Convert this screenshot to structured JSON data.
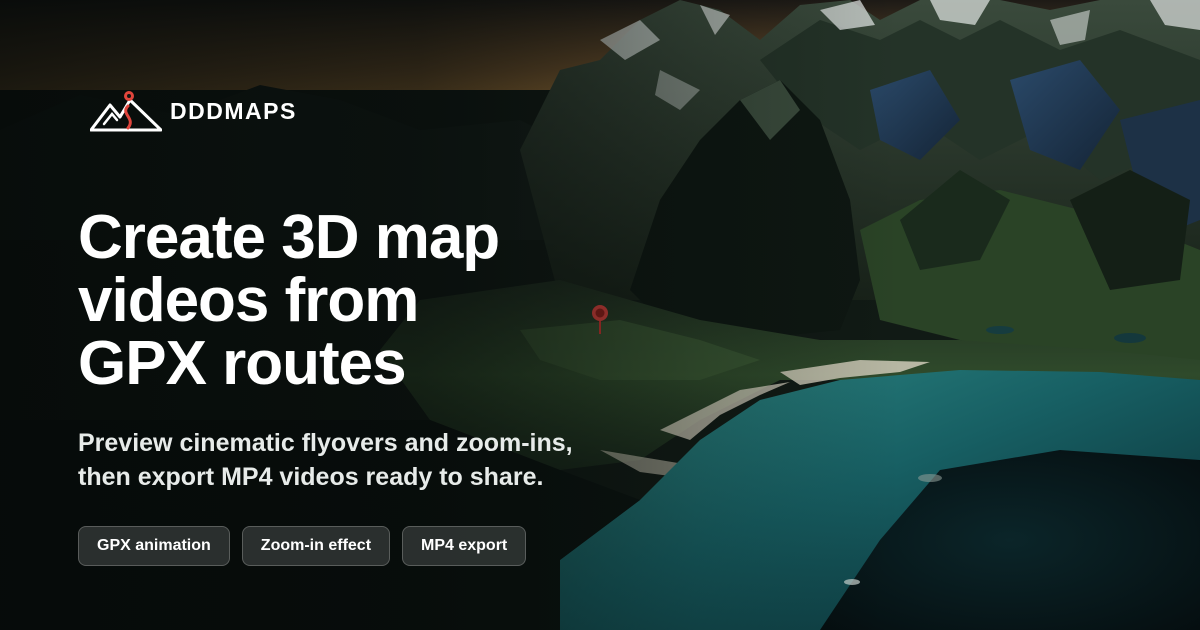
{
  "brand": {
    "name": "DDDMAPS",
    "logo_icon": "mountain-route-pin-icon",
    "accent_color": "#e0453c"
  },
  "hero": {
    "headline_lines": [
      "Create 3D map",
      "videos from",
      "GPX routes"
    ],
    "subtitle_lines": [
      "Preview cinematic flyovers and zoom-ins,",
      "then export MP4 videos ready to share."
    ]
  },
  "features": [
    {
      "label": "GPX animation"
    },
    {
      "label": "Zoom-in effect"
    },
    {
      "label": "MP4 export"
    }
  ],
  "map": {
    "marker_icon": "location-pin-icon",
    "marker_color": "#d8413c"
  }
}
